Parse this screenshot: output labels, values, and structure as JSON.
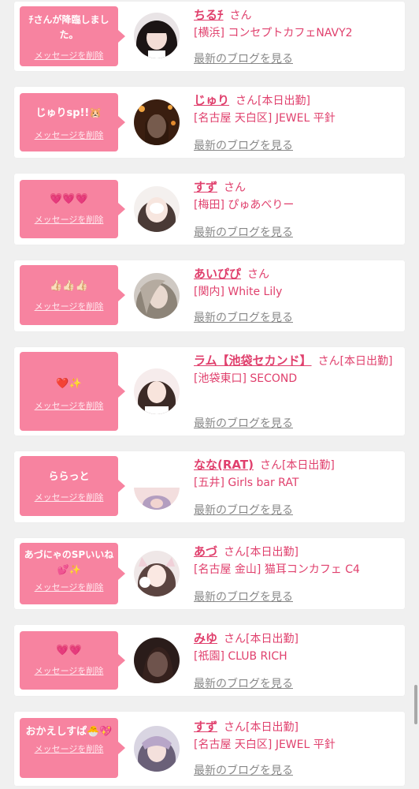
{
  "colors": {
    "accent": "#e0406d",
    "bubble": "#f783a0",
    "card": "#ffffff",
    "bg": "#f0f0f0",
    "link_gray": "#888888"
  },
  "common": {
    "delete_label": "メッセージを削除",
    "blog_label": "最新のブログを見る"
  },
  "items": [
    {
      "message": "ﾁさんが降臨しました。",
      "name": "ちるﾁ",
      "suffix": "さん",
      "location": "[横浜] コンセプトカフェNAVY2"
    },
    {
      "message": "じゅりsp!!🐹",
      "name": "じゅり",
      "suffix": "さん[本日出勤]",
      "location": "[名古屋 天白区] JEWEL 平針"
    },
    {
      "message": "💗💗💗",
      "name": "すず",
      "suffix": "さん",
      "location": "[梅田] ぴゅあべりー"
    },
    {
      "message": "👍🏻👍🏻👍🏻",
      "name": "あいぴぴ",
      "suffix": "さん",
      "location": "[関内] White Lily"
    },
    {
      "message": "❤️✨",
      "name": "ラム【池袋セカンド】",
      "suffix": "さん[本日出勤]",
      "location": "[池袋東口] SECOND"
    },
    {
      "message": "ららっと",
      "name": "なな(RAT)",
      "suffix": "さん[本日出勤]",
      "location": "[五井] Girls bar RAT"
    },
    {
      "message": "あづにゃのSPいいね💕✨",
      "name": "あづ",
      "suffix": "さん[本日出勤]",
      "location": "[名古屋 金山] 猫耳コンカフェ C4"
    },
    {
      "message": "💗💗",
      "name": "みゆ",
      "suffix": "さん[本日出勤]",
      "location": "[祇園] CLUB RICH"
    },
    {
      "message": "おかえしすぱ🐣💖",
      "name": "すず",
      "suffix": "さん[本日出勤]",
      "location": "[名古屋 天白区] JEWEL 平針"
    }
  ]
}
